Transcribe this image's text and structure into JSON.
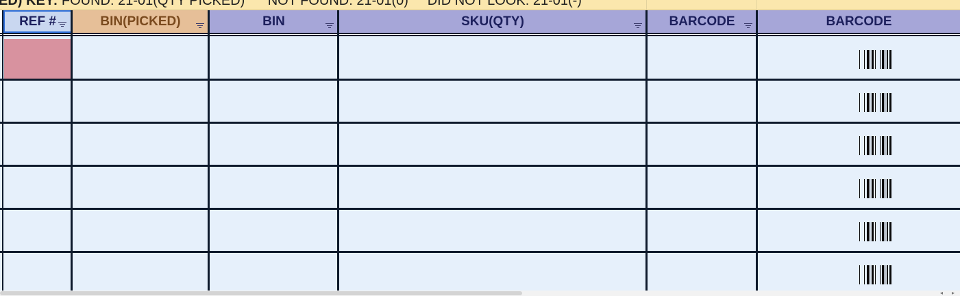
{
  "key_banner": {
    "label": "ED) KEY:",
    "found": "FOUND: 21-01(QTY PICKED)",
    "not_found": "NOT FOUND: 21-01(0)",
    "did_not_look": "DID NOT LOOK: 21-01(-)"
  },
  "columns": [
    {
      "label": "REF #",
      "filter": true
    },
    {
      "label": "BIN(PICKED)",
      "filter": true
    },
    {
      "label": "BIN",
      "filter": true
    },
    {
      "label": "SKU(QTY)",
      "filter": true
    },
    {
      "label": "BARCODE",
      "filter": true
    },
    {
      "label": "BARCODE",
      "filter": false
    }
  ],
  "row_count": 6,
  "colors": {
    "header_lavender": "#a6a6d8",
    "header_tan": "#e6bf98",
    "row_fill": "#e6f0fb",
    "highlight_cell": "#d8929f",
    "key_banner": "#fbe7ad",
    "grid_border": "#0e1a2c"
  },
  "icons": [
    "filter-dropdown-icon",
    "barcode-icon",
    "scroll-left-icon",
    "scroll-right-icon"
  ]
}
